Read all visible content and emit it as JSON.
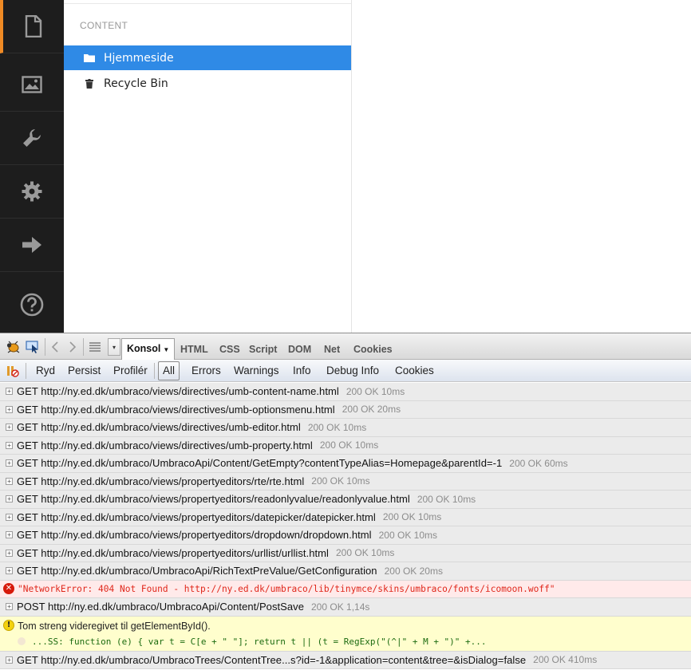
{
  "sidebar": {
    "items": [
      {
        "name": "content",
        "icon": "document-icon"
      },
      {
        "name": "media",
        "icon": "image-icon"
      },
      {
        "name": "settings",
        "icon": "wrench-icon"
      },
      {
        "name": "developer",
        "icon": "gear-icon"
      },
      {
        "name": "users",
        "icon": "arrow-right-icon"
      }
    ],
    "help_icon": "help-circle-icon",
    "active_color": "#f08a24"
  },
  "tree": {
    "heading": "CONTENT",
    "items": [
      {
        "label": "Hjemmeside",
        "icon": "folder-icon",
        "selected": true
      },
      {
        "label": "Recycle Bin",
        "icon": "trash-icon",
        "selected": false
      }
    ],
    "selected_color": "#2f8ae6"
  },
  "firebug": {
    "toolbar": {
      "active_tab": "Konsol",
      "tabs": [
        "HTML",
        "CSS",
        "Script",
        "DOM",
        "Net",
        "Cookies"
      ]
    },
    "filter": {
      "actions": [
        "Ryd",
        "Persist",
        "Profilér"
      ],
      "tabs": [
        "All",
        "Errors",
        "Warnings",
        "Info",
        "Debug Info",
        "Cookies"
      ],
      "active": "All"
    },
    "log": {
      "rows": [
        {
          "req": "GET http://ny.ed.dk/umbraco/views/directives/umb-content-name.html",
          "stat": "200 OK 10ms"
        },
        {
          "req": "GET http://ny.ed.dk/umbraco/views/directives/umb-optionsmenu.html",
          "stat": "200 OK 20ms"
        },
        {
          "req": "GET http://ny.ed.dk/umbraco/views/directives/umb-editor.html",
          "stat": "200 OK 10ms"
        },
        {
          "req": "GET http://ny.ed.dk/umbraco/views/directives/umb-property.html",
          "stat": "200 OK 10ms"
        },
        {
          "req": "GET http://ny.ed.dk/umbraco/UmbracoApi/Content/GetEmpty?contentTypeAlias=Homepage&parentId=-1",
          "stat": "200 OK 60ms"
        },
        {
          "req": "GET http://ny.ed.dk/umbraco/views/propertyeditors/rte/rte.html",
          "stat": "200 OK 10ms"
        },
        {
          "req": "GET http://ny.ed.dk/umbraco/views/propertyeditors/readonlyvalue/readonlyvalue.html",
          "stat": "200 OK 10ms"
        },
        {
          "req": "GET http://ny.ed.dk/umbraco/views/propertyeditors/datepicker/datepicker.html",
          "stat": "200 OK 10ms"
        },
        {
          "req": "GET http://ny.ed.dk/umbraco/views/propertyeditors/dropdown/dropdown.html",
          "stat": "200 OK 10ms"
        },
        {
          "req": "GET http://ny.ed.dk/umbraco/views/propertyeditors/urllist/urllist.html",
          "stat": "200 OK 10ms"
        },
        {
          "req": "GET http://ny.ed.dk/umbraco/UmbracoApi/RichTextPreValue/GetConfiguration",
          "stat": "200 OK 20ms"
        }
      ],
      "error": "\"NetworkError: 404 Not Found - http://ny.ed.dk/umbraco/lib/tinymce/skins/umbraco/fonts/icomoon.woff\"",
      "post": {
        "req": "POST http://ny.ed.dk/umbraco/UmbracoApi/Content/PostSave",
        "stat": "200 OK 1,14s"
      },
      "warning": {
        "message": "Tom streng videregivet til getElementById().",
        "code": "...SS: function (e) { var t = C[e + \" \"]; return t || (t = RegExp(\"(^|\" + M + \")\" +..."
      },
      "last": {
        "req": "GET http://ny.ed.dk/umbraco/UmbracoTrees/ContentTree...s?id=-1&application=content&tree=&isDialog=false",
        "stat": "200 OK 410ms"
      }
    }
  }
}
